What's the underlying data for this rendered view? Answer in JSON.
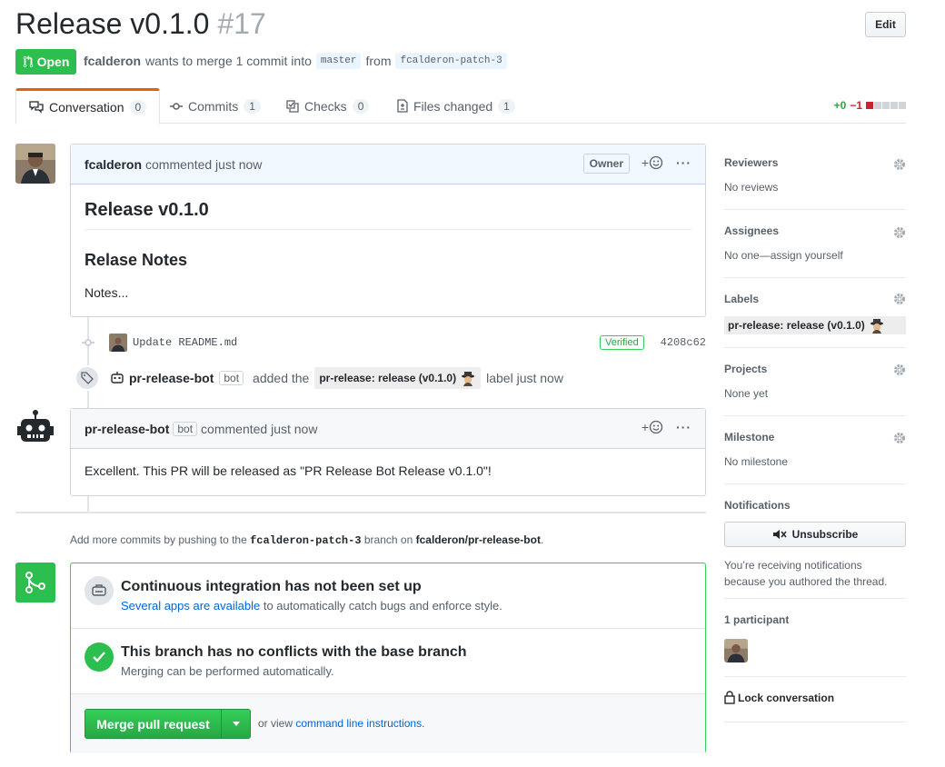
{
  "header": {
    "title": "Release v0.1.0",
    "number": "#17",
    "edit_label": "Edit",
    "state": "Open",
    "author": "fcalderon",
    "merge_text": "wants to merge 1 commit into",
    "base_branch": "master",
    "from_text": "from",
    "head_branch": "fcalderon-patch-3"
  },
  "tabs": [
    {
      "label": "Conversation",
      "count": "0",
      "icon": "comment-discussion-icon"
    },
    {
      "label": "Commits",
      "count": "1",
      "icon": "git-commit-icon"
    },
    {
      "label": "Checks",
      "count": "0",
      "icon": "checklist-icon"
    },
    {
      "label": "Files changed",
      "count": "1",
      "icon": "file-diff-icon"
    }
  ],
  "diffstat": {
    "additions": "+0",
    "deletions": "−1"
  },
  "comment1": {
    "author": "fcalderon",
    "meta": "commented just now",
    "role": "Owner",
    "h1": "Release v0.1.0",
    "h2": "Relase Notes",
    "body": "Notes..."
  },
  "commit": {
    "message": "Update README.md",
    "verified": "Verified",
    "sha": "4208c62"
  },
  "label_event": {
    "actor": "pr-release-bot",
    "bot": "bot",
    "pre": "added the",
    "label": "pr-release: release (v0.1.0)",
    "post": "label just now"
  },
  "comment2": {
    "author": "pr-release-bot",
    "bot": "bot",
    "meta": "commented just now",
    "body": "Excellent. This PR will be released as \"PR Release Bot Release v0.1.0\"!"
  },
  "push_hint": {
    "pre": "Add more commits by pushing to the",
    "branch": "fcalderon-patch-3",
    "mid": "branch on",
    "repo": "fcalderon/pr-release-bot",
    "end": "."
  },
  "merge": {
    "ci_title": "Continuous integration has not been set up",
    "ci_link": "Several apps are available",
    "ci_rest": "to automatically catch bugs and enforce style.",
    "conflict_title": "This branch has no conflicts with the base branch",
    "conflict_sub": "Merging can be performed automatically.",
    "button": "Merge pull request",
    "or_view": "or view",
    "cli_link": "command line instructions",
    "cli_end": "."
  },
  "sidebar": {
    "reviewers": {
      "title": "Reviewers",
      "value": "No reviews"
    },
    "assignees": {
      "title": "Assignees",
      "value": "No one—assign yourself"
    },
    "labels": {
      "title": "Labels",
      "value": "pr-release: release (v0.1.0)"
    },
    "projects": {
      "title": "Projects",
      "value": "None yet"
    },
    "milestone": {
      "title": "Milestone",
      "value": "No milestone"
    },
    "notifications": {
      "title": "Notifications",
      "button": "Unsubscribe",
      "line1": "You’re receiving notifications",
      "line2": "because you authored the thread."
    },
    "participants": {
      "title": "1 participant"
    },
    "lock": "Lock conversation"
  },
  "colors": {
    "green": "#2cbe4e",
    "link": "#0366d6",
    "label_bg": "#ededed"
  }
}
